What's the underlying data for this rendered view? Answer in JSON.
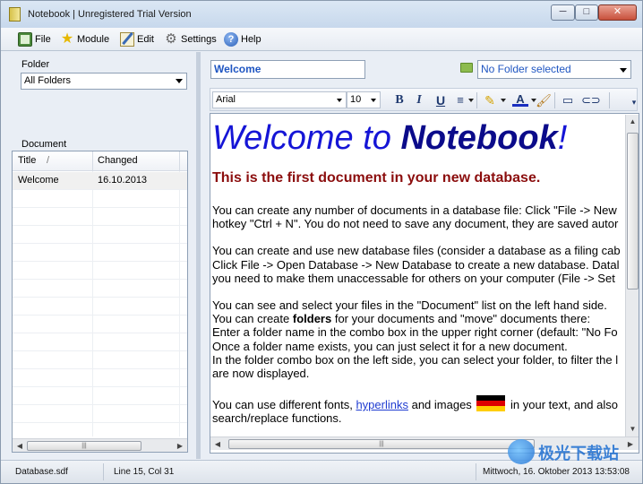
{
  "window": {
    "title": "Notebook | Unregistered Trial Version",
    "min_label": "─",
    "max_label": "□",
    "close_label": "✕"
  },
  "menu": {
    "file": "File",
    "module": "Module",
    "edit": "Edit",
    "settings": "Settings",
    "help": "Help"
  },
  "left": {
    "folder_label": "Folder",
    "folder_value": "All Folders",
    "document_label": "Document",
    "columns": {
      "title": "Title",
      "sort_indicator": "/",
      "changed": "Changed"
    },
    "rows": [
      {
        "title": "Welcome",
        "changed": "16.10.2013"
      }
    ]
  },
  "right": {
    "title_value": "Welcome",
    "folder_combo_value": "No Folder selected",
    "font": "Arial",
    "size": "10",
    "bold": "B",
    "italic": "I",
    "underline": "U"
  },
  "doc": {
    "h1_start": "Welcome to ",
    "h1_bold": "Notebook",
    "h1_end": "!",
    "h2": "This is the first document in your new database.",
    "p1a": "You can create any number of documents in a database file: Click \"File -> New",
    "p1b": "hotkey \"Ctrl + N\". You do not need to save any document, they are saved autor",
    "p2a": "You can create and use new database files (consider a database as a filing cab",
    "p2b": "Click File -> Open Database -> New Database to create a new database. Datal",
    "p2c": "you need to make them unaccessable for others on your computer (File -> Set",
    "p3a": "You can see and select your files in the \"Document\" list on the left hand side.",
    "p3b_start": "You can create ",
    "p3b_bold": "folders",
    "p3b_end": " for your documents and \"move\" documents there:",
    "p3c": "Enter a folder name in the combo box in the upper right corner (default: \"No Fo",
    "p3d": "Once a folder name exists, you can just select it for a new document.",
    "p3e": "In the folder combo box on the left side, you can select your folder, to filter the l",
    "p3f": "are now displayed.",
    "p4a_start": "You can use different fonts, ",
    "p4a_link": "hyperlinks",
    "p4a_mid": " and images ",
    "p4a_end": " in your text, and also ",
    "p4b": "search/replace functions."
  },
  "status": {
    "file": "Database.sdf",
    "position": "Line 15, Col 31",
    "datetime": "Mittwoch, 16. Oktober 2013 13:53:08"
  },
  "watermark": {
    "text": "极光下载站"
  },
  "icons": {
    "file": "file-icon",
    "module": "star-icon",
    "edit": "edit-icon",
    "settings": "gear-icon",
    "help": "help-icon",
    "folder": "folder-icon",
    "highlight": "highlighter-icon",
    "font_color": "font-color-icon",
    "clear_format": "brush-icon",
    "image": "image-icon",
    "link": "link-icon"
  },
  "colors": {
    "accent_blue": "#1f56c2",
    "heading_red": "#8b0d0d",
    "heading_blue": "#1515d6"
  }
}
